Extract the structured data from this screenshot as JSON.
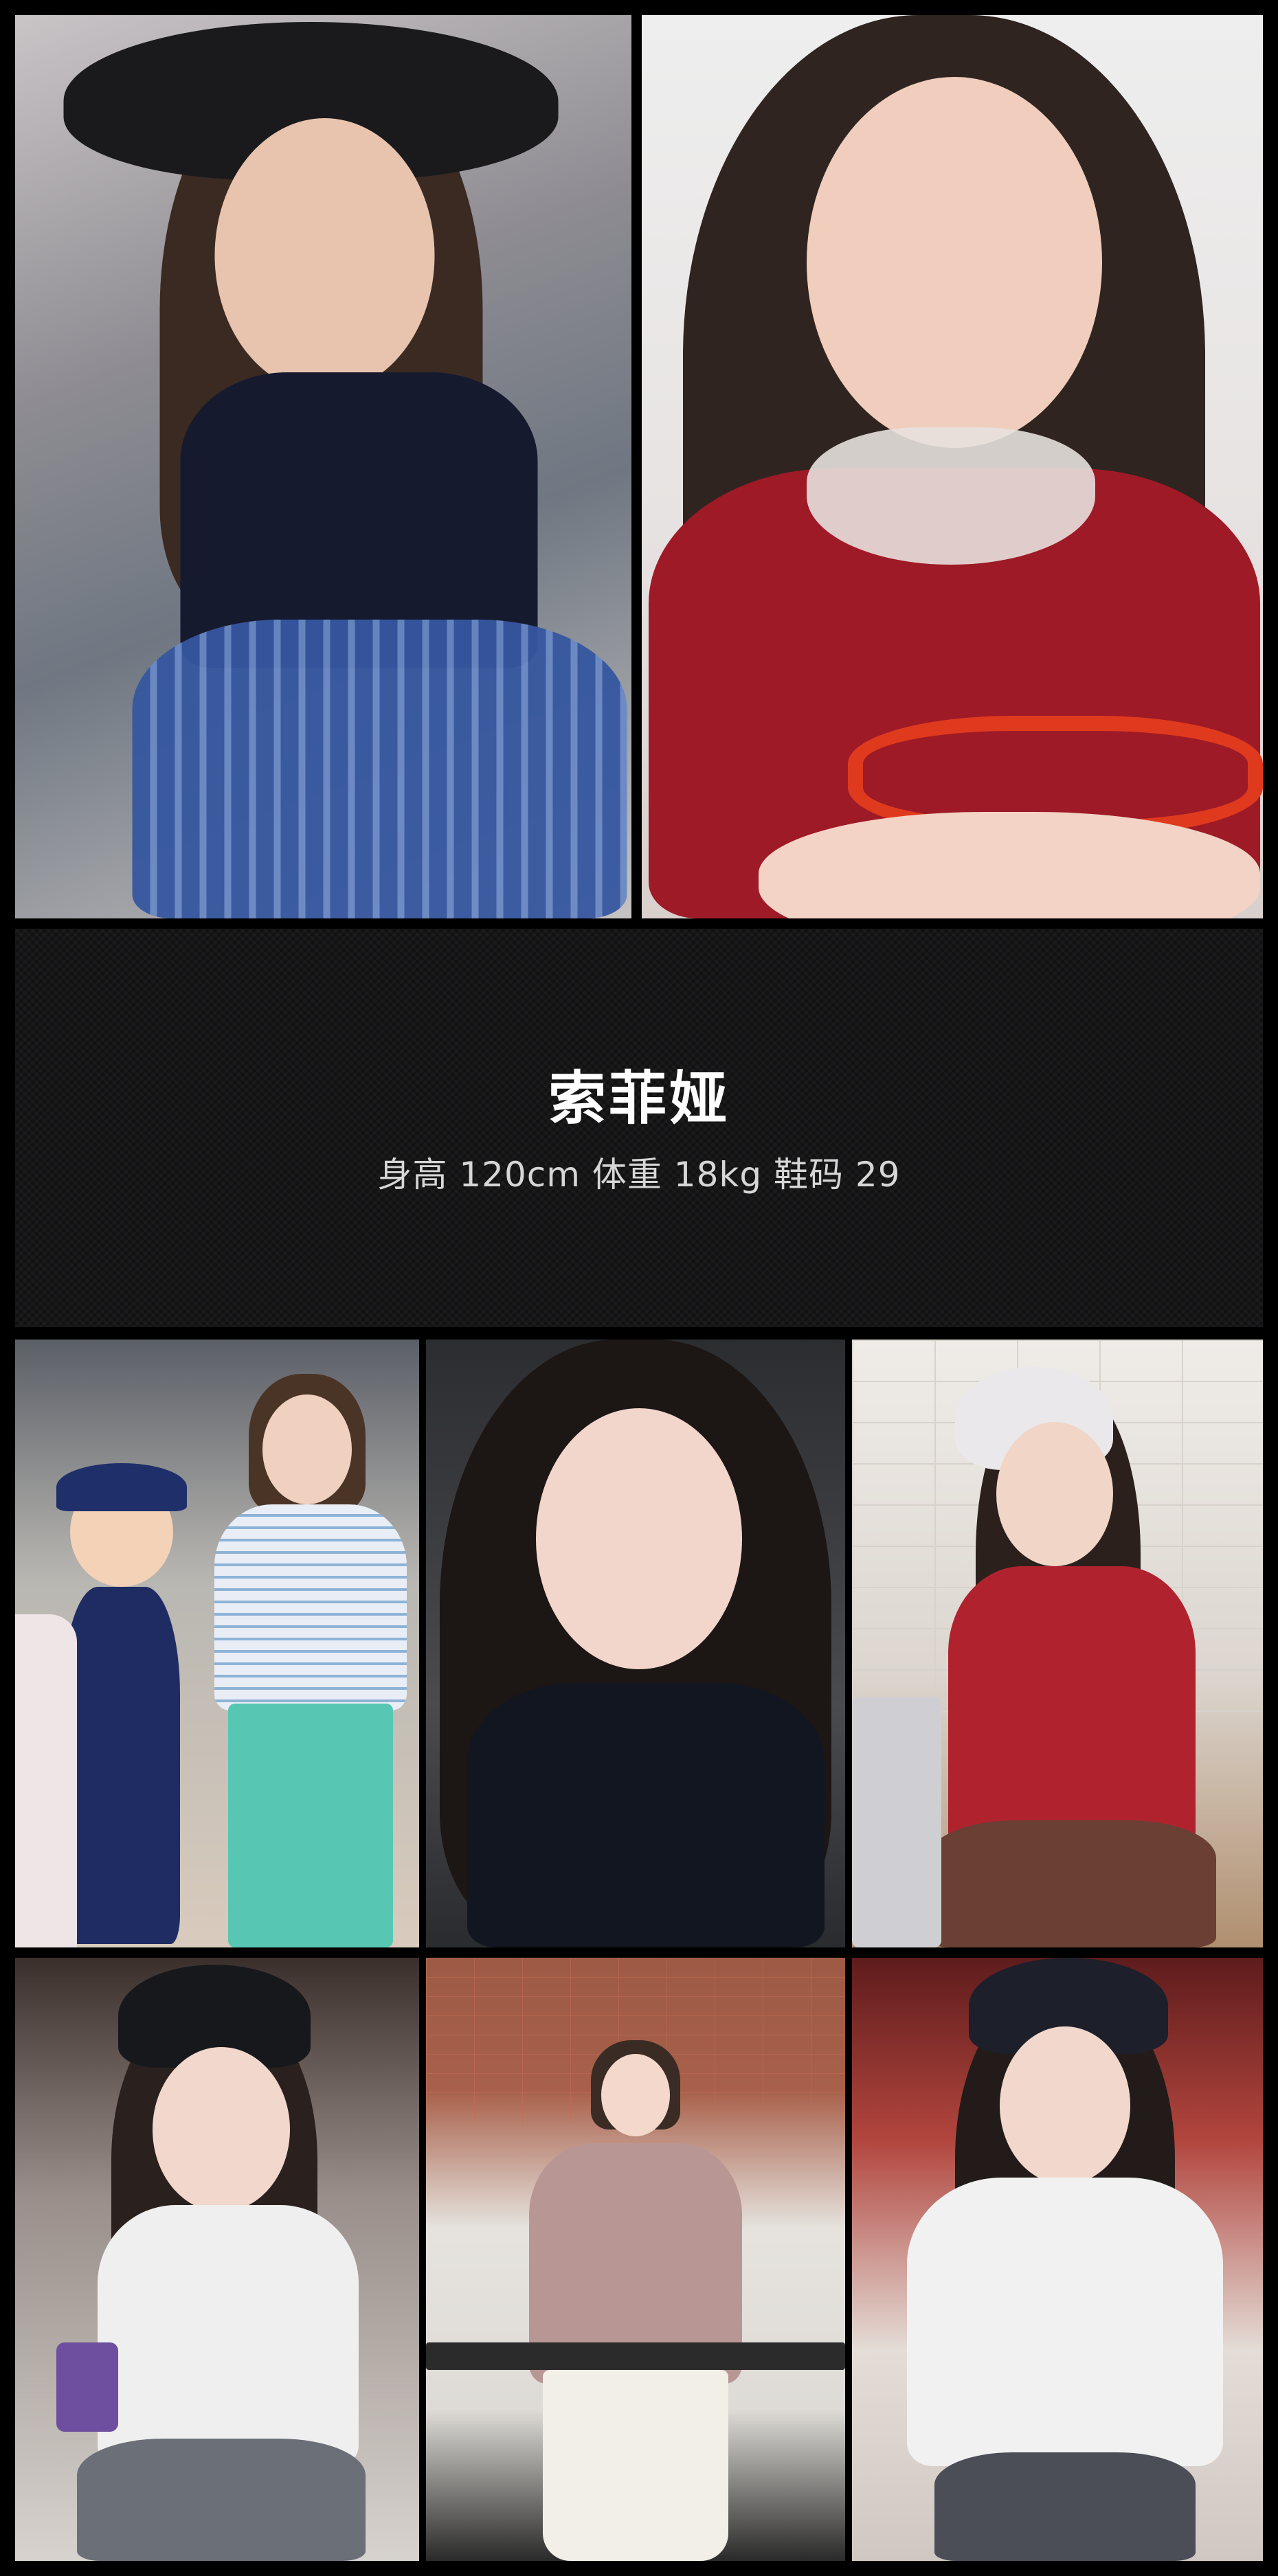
{
  "profile": {
    "name": "索菲娅",
    "stats": "身高 120cm  体重 18kg  鞋码 29"
  },
  "colors": {
    "background": "#000000",
    "banner": "#111112",
    "name_text": "#ffffff",
    "stats_text": "#d6d6d6"
  }
}
